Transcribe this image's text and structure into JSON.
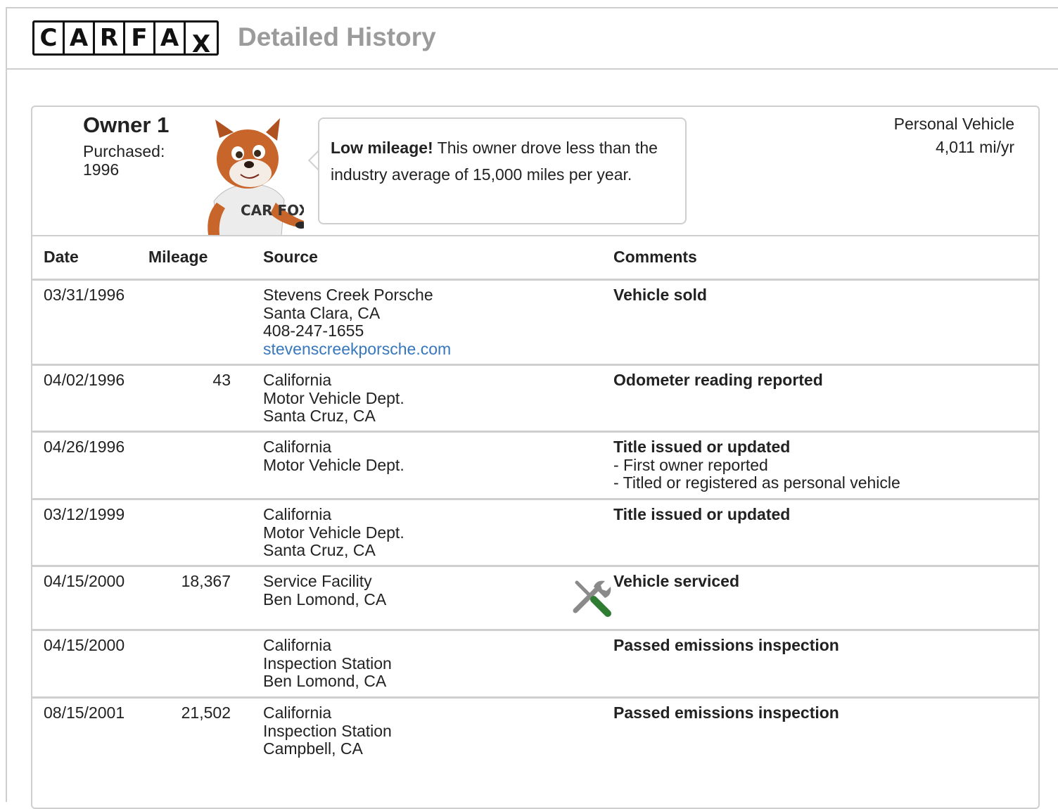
{
  "header": {
    "logo_letters": [
      "C",
      "A",
      "R",
      "F",
      "A",
      "X"
    ],
    "title": "Detailed History"
  },
  "owner": {
    "title": "Owner 1",
    "purchased_line1": "Purchased:",
    "purchased_line2": "1996",
    "fox_shirt": "CAR FOX",
    "bubble_bold": "Low mileage!",
    "bubble_text": " This owner drove less than the industry average of 15,000 miles per year.",
    "vehicle_type": "Personal Vehicle",
    "mileage_rate": "4,011 mi/yr"
  },
  "table": {
    "headers": {
      "date": "Date",
      "mileage": "Mileage",
      "source": "Source",
      "comments": "Comments"
    },
    "rows": [
      {
        "date": "03/31/1996",
        "mileage": "",
        "source": [
          "Stevens Creek Porsche",
          "Santa Clara, CA",
          "408-247-1655"
        ],
        "source_link": "stevenscreekporsche.com",
        "comment_title": "Vehicle sold",
        "comment_lines": []
      },
      {
        "date": "04/02/1996",
        "mileage": "43",
        "source": [
          "California",
          "Motor Vehicle Dept.",
          "Santa Cruz, CA"
        ],
        "source_link": "",
        "comment_title": "Odometer reading reported",
        "comment_lines": []
      },
      {
        "date": "04/26/1996",
        "mileage": "",
        "source": [
          "California",
          "Motor Vehicle Dept."
        ],
        "source_link": "",
        "comment_title": "Title issued or updated",
        "comment_lines": [
          "- First owner reported",
          "- Titled or registered as personal vehicle"
        ]
      },
      {
        "date": "03/12/1999",
        "mileage": "",
        "source": [
          "California",
          "Motor Vehicle Dept.",
          "Santa Cruz, CA"
        ],
        "source_link": "",
        "comment_title": "Title issued or updated",
        "comment_lines": []
      },
      {
        "date": "04/15/2000",
        "mileage": "18,367",
        "source": [
          "Service Facility",
          "Ben Lomond, CA"
        ],
        "source_link": "",
        "comment_title": "Vehicle serviced",
        "comment_lines": [],
        "icon": "wrench-screwdriver-icon"
      },
      {
        "date": "04/15/2000",
        "mileage": "",
        "source": [
          "California",
          "Inspection Station",
          "Ben Lomond, CA"
        ],
        "source_link": "",
        "comment_title": "Passed emissions inspection",
        "comment_lines": []
      },
      {
        "date": "08/15/2001",
        "mileage": "21,502",
        "source": [
          "California",
          "Inspection Station",
          "Campbell, CA"
        ],
        "source_link": "",
        "comment_title": "Passed emissions inspection",
        "comment_lines": []
      }
    ]
  },
  "colors": {
    "link": "#3777bc",
    "border": "#cfcfcf",
    "title_gray": "#9b9b9b",
    "screwdriver_green": "#2e7d32"
  }
}
